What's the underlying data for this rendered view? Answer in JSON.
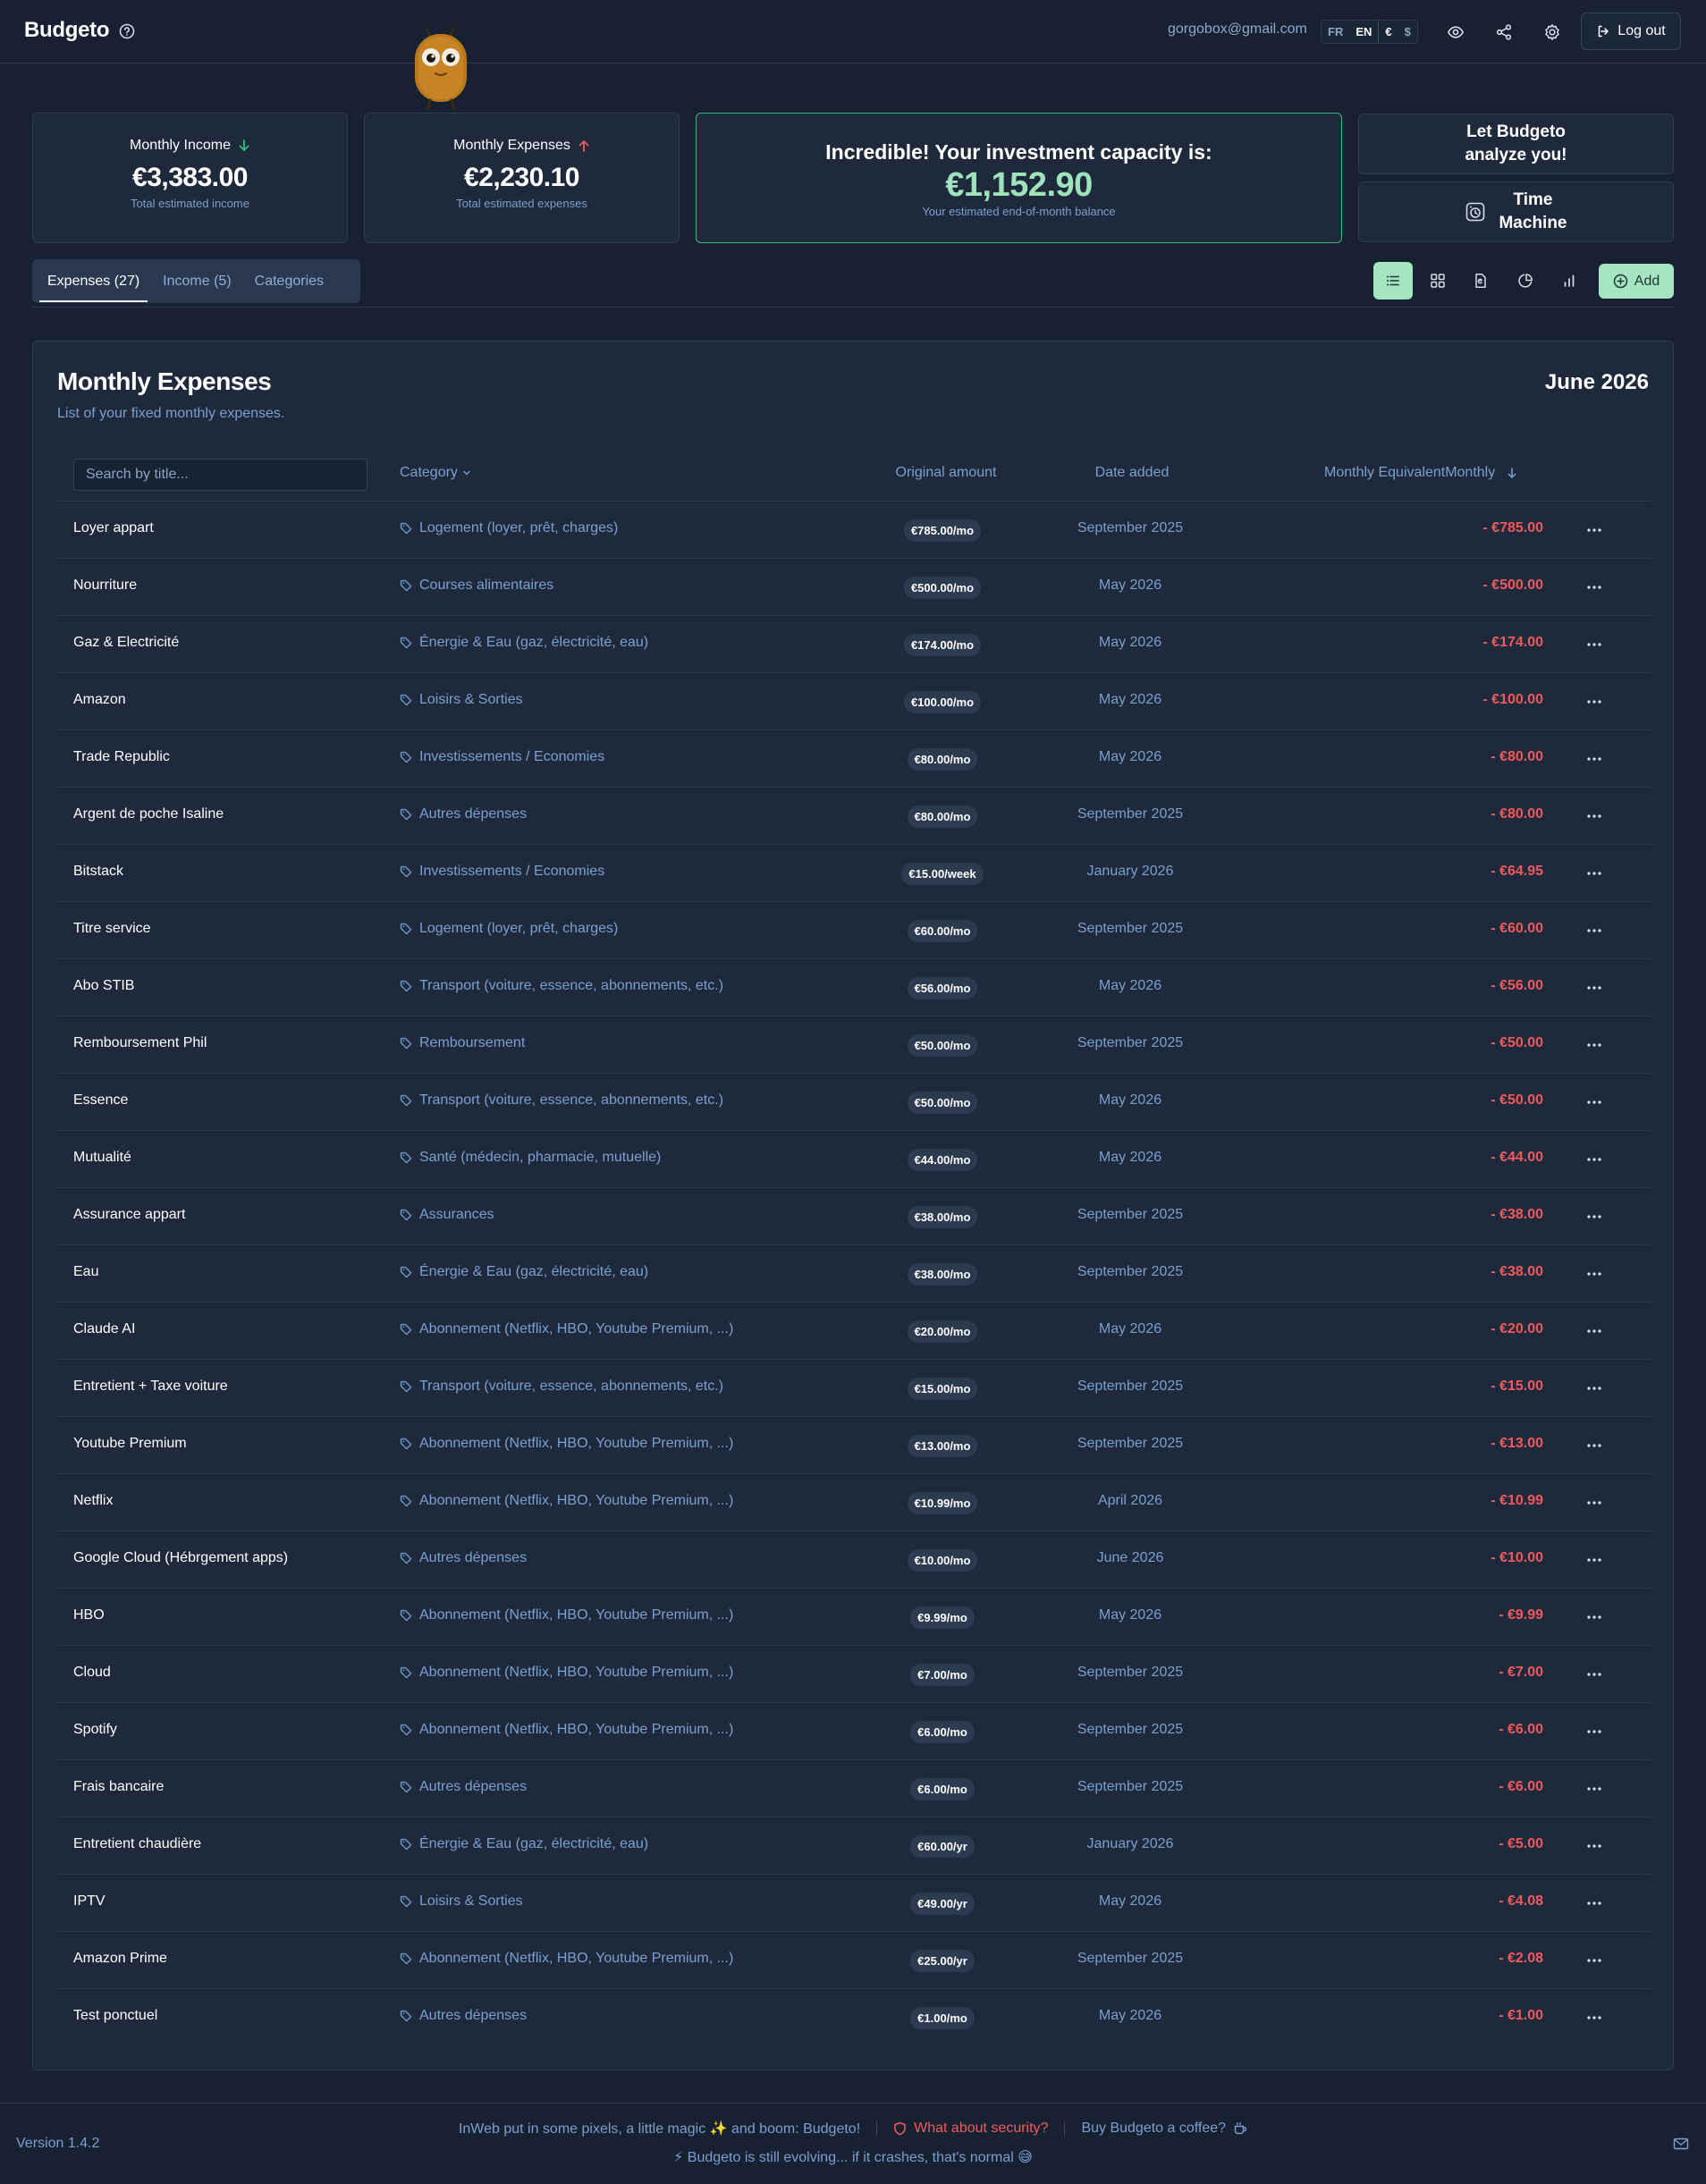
{
  "app": {
    "name": "Budgeto"
  },
  "header": {
    "email": "gorgobox@gmail.com",
    "languages": [
      "FR",
      "EN"
    ],
    "active_language": "EN",
    "currencies": [
      "€",
      "$"
    ],
    "active_currency": "€",
    "logout_label": "Log out"
  },
  "cards": {
    "income": {
      "label": "Monthly Income",
      "amount": "€3,383.00",
      "sub": "Total estimated income"
    },
    "expenses": {
      "label": "Monthly Expenses",
      "amount": "€2,230.10",
      "sub": "Total estimated expenses"
    },
    "capacity": {
      "label": "Incredible! Your investment capacity is:",
      "amount": "€1,152.90",
      "sub": "Your estimated end-of-month balance"
    },
    "analyze": {
      "line1": "Let Budgeto",
      "line2": "analyze you!"
    },
    "time_machine": {
      "line1": "Time",
      "line2": "Machine"
    }
  },
  "tabs": [
    {
      "label": "Expenses (27)",
      "active": true
    },
    {
      "label": "Income (5)",
      "active": false
    },
    {
      "label": "Categories",
      "active": false
    }
  ],
  "toolbar": {
    "add_label": "Add"
  },
  "panel": {
    "title": "Monthly Expenses",
    "subtitle": "List of your fixed monthly expenses.",
    "month": "June 2026",
    "search_placeholder": "Search by title...",
    "columns": {
      "category": "Category",
      "original": "Original amount",
      "date": "Date added",
      "monthly": "Monthly EquivalentMonthly"
    }
  },
  "expenses": [
    {
      "title": "Loyer appart",
      "category": "Logement (loyer, prêt, charges)",
      "original": "€785.00/mo",
      "date": "September 2025",
      "monthly": "- €785.00"
    },
    {
      "title": "Nourriture",
      "category": "Courses alimentaires",
      "original": "€500.00/mo",
      "date": "May 2026",
      "monthly": "- €500.00"
    },
    {
      "title": "Gaz & Electricité",
      "category": "Énergie & Eau (gaz, électricité, eau)",
      "original": "€174.00/mo",
      "date": "May 2026",
      "monthly": "- €174.00"
    },
    {
      "title": "Amazon",
      "category": "Loisirs & Sorties",
      "original": "€100.00/mo",
      "date": "May 2026",
      "monthly": "- €100.00"
    },
    {
      "title": "Trade Republic",
      "category": "Investissements / Economies",
      "original": "€80.00/mo",
      "date": "May 2026",
      "monthly": "- €80.00"
    },
    {
      "title": "Argent de poche Isaline",
      "category": "Autres dépenses",
      "original": "€80.00/mo",
      "date": "September 2025",
      "monthly": "- €80.00"
    },
    {
      "title": "Bitstack",
      "category": "Investissements / Economies",
      "original": "€15.00/week",
      "date": "January 2026",
      "monthly": "- €64.95"
    },
    {
      "title": "Titre service",
      "category": "Logement (loyer, prêt, charges)",
      "original": "€60.00/mo",
      "date": "September 2025",
      "monthly": "- €60.00"
    },
    {
      "title": "Abo STIB",
      "category": "Transport (voiture, essence, abonnements, etc.)",
      "original": "€56.00/mo",
      "date": "May 2026",
      "monthly": "- €56.00"
    },
    {
      "title": "Remboursement Phil",
      "category": "Remboursement",
      "original": "€50.00/mo",
      "date": "September 2025",
      "monthly": "- €50.00"
    },
    {
      "title": "Essence",
      "category": "Transport (voiture, essence, abonnements, etc.)",
      "original": "€50.00/mo",
      "date": "May 2026",
      "monthly": "- €50.00"
    },
    {
      "title": "Mutualité",
      "category": "Santé (médecin, pharmacie, mutuelle)",
      "original": "€44.00/mo",
      "date": "May 2026",
      "monthly": "- €44.00"
    },
    {
      "title": "Assurance appart",
      "category": "Assurances",
      "original": "€38.00/mo",
      "date": "September 2025",
      "monthly": "- €38.00"
    },
    {
      "title": "Eau",
      "category": "Énergie & Eau (gaz, électricité, eau)",
      "original": "€38.00/mo",
      "date": "September 2025",
      "monthly": "- €38.00"
    },
    {
      "title": "Claude AI",
      "category": "Abonnement (Netflix, HBO, Youtube Premium, ...)",
      "original": "€20.00/mo",
      "date": "May 2026",
      "monthly": "- €20.00"
    },
    {
      "title": "Entretient + Taxe voiture",
      "category": "Transport (voiture, essence, abonnements, etc.)",
      "original": "€15.00/mo",
      "date": "September 2025",
      "monthly": "- €15.00"
    },
    {
      "title": "Youtube Premium",
      "category": "Abonnement (Netflix, HBO, Youtube Premium, ...)",
      "original": "€13.00/mo",
      "date": "September 2025",
      "monthly": "- €13.00"
    },
    {
      "title": "Netflix",
      "category": "Abonnement (Netflix, HBO, Youtube Premium, ...)",
      "original": "€10.99/mo",
      "date": "April 2026",
      "monthly": "- €10.99"
    },
    {
      "title": "Google Cloud (Hébrgement apps)",
      "category": "Autres dépenses",
      "original": "€10.00/mo",
      "date": "June 2026",
      "monthly": "- €10.00"
    },
    {
      "title": "HBO",
      "category": "Abonnement (Netflix, HBO, Youtube Premium, ...)",
      "original": "€9.99/mo",
      "date": "May 2026",
      "monthly": "- €9.99"
    },
    {
      "title": "Cloud",
      "category": "Abonnement (Netflix, HBO, Youtube Premium, ...)",
      "original": "€7.00/mo",
      "date": "September 2025",
      "monthly": "- €7.00"
    },
    {
      "title": "Spotify",
      "category": "Abonnement (Netflix, HBO, Youtube Premium, ...)",
      "original": "€6.00/mo",
      "date": "September 2025",
      "monthly": "- €6.00"
    },
    {
      "title": "Frais bancaire",
      "category": "Autres dépenses",
      "original": "€6.00/mo",
      "date": "September 2025",
      "monthly": "- €6.00"
    },
    {
      "title": "Entretient chaudière",
      "category": "Énergie & Eau (gaz, électricité, eau)",
      "original": "€60.00/yr",
      "date": "January 2026",
      "monthly": "- €5.00"
    },
    {
      "title": "IPTV",
      "category": "Loisirs & Sorties",
      "original": "€49.00/yr",
      "date": "May 2026",
      "monthly": "- €4.08"
    },
    {
      "title": "Amazon Prime",
      "category": "Abonnement (Netflix, HBO, Youtube Premium, ...)",
      "original": "€25.00/yr",
      "date": "September 2025",
      "monthly": "- €2.08"
    },
    {
      "title": "Test ponctuel",
      "category": "Autres dépenses",
      "original": "€1.00/mo",
      "date": "May 2026",
      "monthly": "- €1.00"
    }
  ],
  "footer": {
    "version": "Version 1.4.2",
    "credit": "InWeb put in some pixels, a little magic ✨ and boom: Budgeto!",
    "security": "What about security?",
    "coffee": "Buy Budgeto a coffee?",
    "evolving": "⚡ Budgeto is still evolving... if it crashes, that's normal 😅"
  },
  "colors": {
    "background": "#172131",
    "card": "#1e2a3b",
    "accent_green": "#a6e5c1",
    "capacity_border": "#3fb77a",
    "expense_red": "#f05a5e",
    "muted_blue": "#7b9fd0"
  }
}
